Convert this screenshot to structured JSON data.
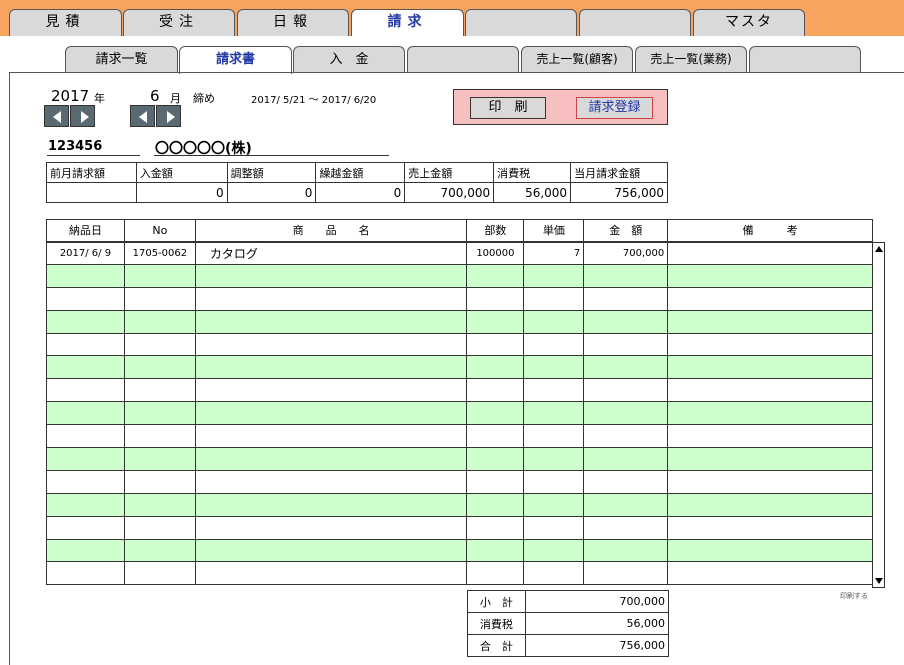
{
  "top_tabs": [
    "見積",
    "受注",
    "日報",
    "請求",
    "",
    "",
    "マスタ"
  ],
  "sub_tabs": [
    "請求一覧",
    "請求書",
    "入　金",
    "",
    "売上一覧(顧客)",
    "売上一覧(業務)",
    ""
  ],
  "period": {
    "year": "2017",
    "year_unit": "年",
    "month": "6",
    "month_unit": "月",
    "closing": "締め",
    "range": "2017/ 5/21 ～ 2017/ 6/20"
  },
  "actions": {
    "print": "印　刷",
    "register": "請求登録"
  },
  "customer": {
    "code": "123456",
    "name": "〇〇〇〇〇(株)"
  },
  "summary": {
    "headers": [
      "前月請求額",
      "入金額",
      "調整額",
      "繰越金額",
      "売上金額",
      "消費税",
      "当月請求金額"
    ],
    "values": [
      "",
      "0",
      "0",
      "0",
      "700,000",
      "56,000",
      "756,000"
    ]
  },
  "items": {
    "headers": [
      "納品日",
      "No",
      "商　　品　　名",
      "部数",
      "単価",
      "金　額",
      "備　　　考"
    ],
    "rows": [
      [
        "2017/ 6/ 9",
        "1705-0062",
        "カタログ",
        "100000",
        "7",
        "700,000",
        ""
      ],
      [
        "",
        "",
        "",
        "",
        "",
        "",
        ""
      ],
      [
        "",
        "",
        "",
        "",
        "",
        "",
        ""
      ],
      [
        "",
        "",
        "",
        "",
        "",
        "",
        ""
      ],
      [
        "",
        "",
        "",
        "",
        "",
        "",
        ""
      ],
      [
        "",
        "",
        "",
        "",
        "",
        "",
        ""
      ],
      [
        "",
        "",
        "",
        "",
        "",
        "",
        ""
      ],
      [
        "",
        "",
        "",
        "",
        "",
        "",
        ""
      ],
      [
        "",
        "",
        "",
        "",
        "",
        "",
        ""
      ],
      [
        "",
        "",
        "",
        "",
        "",
        "",
        ""
      ],
      [
        "",
        "",
        "",
        "",
        "",
        "",
        ""
      ],
      [
        "",
        "",
        "",
        "",
        "",
        "",
        ""
      ],
      [
        "",
        "",
        "",
        "",
        "",
        "",
        ""
      ],
      [
        "",
        "",
        "",
        "",
        "",
        "",
        ""
      ],
      [
        "",
        "",
        "",
        "",
        "",
        "",
        ""
      ]
    ]
  },
  "print_flag": "印刷する",
  "totals": [
    {
      "label": "小　計",
      "value": "700,000"
    },
    {
      "label": "消費税",
      "value": "56,000"
    },
    {
      "label": "合　計",
      "value": "756,000"
    }
  ],
  "colors": {
    "top_bar": "#f7a45f",
    "active_tab_text": "#2239a8",
    "row_green": "#ccffcc",
    "print_box": "#f7c0c0"
  }
}
